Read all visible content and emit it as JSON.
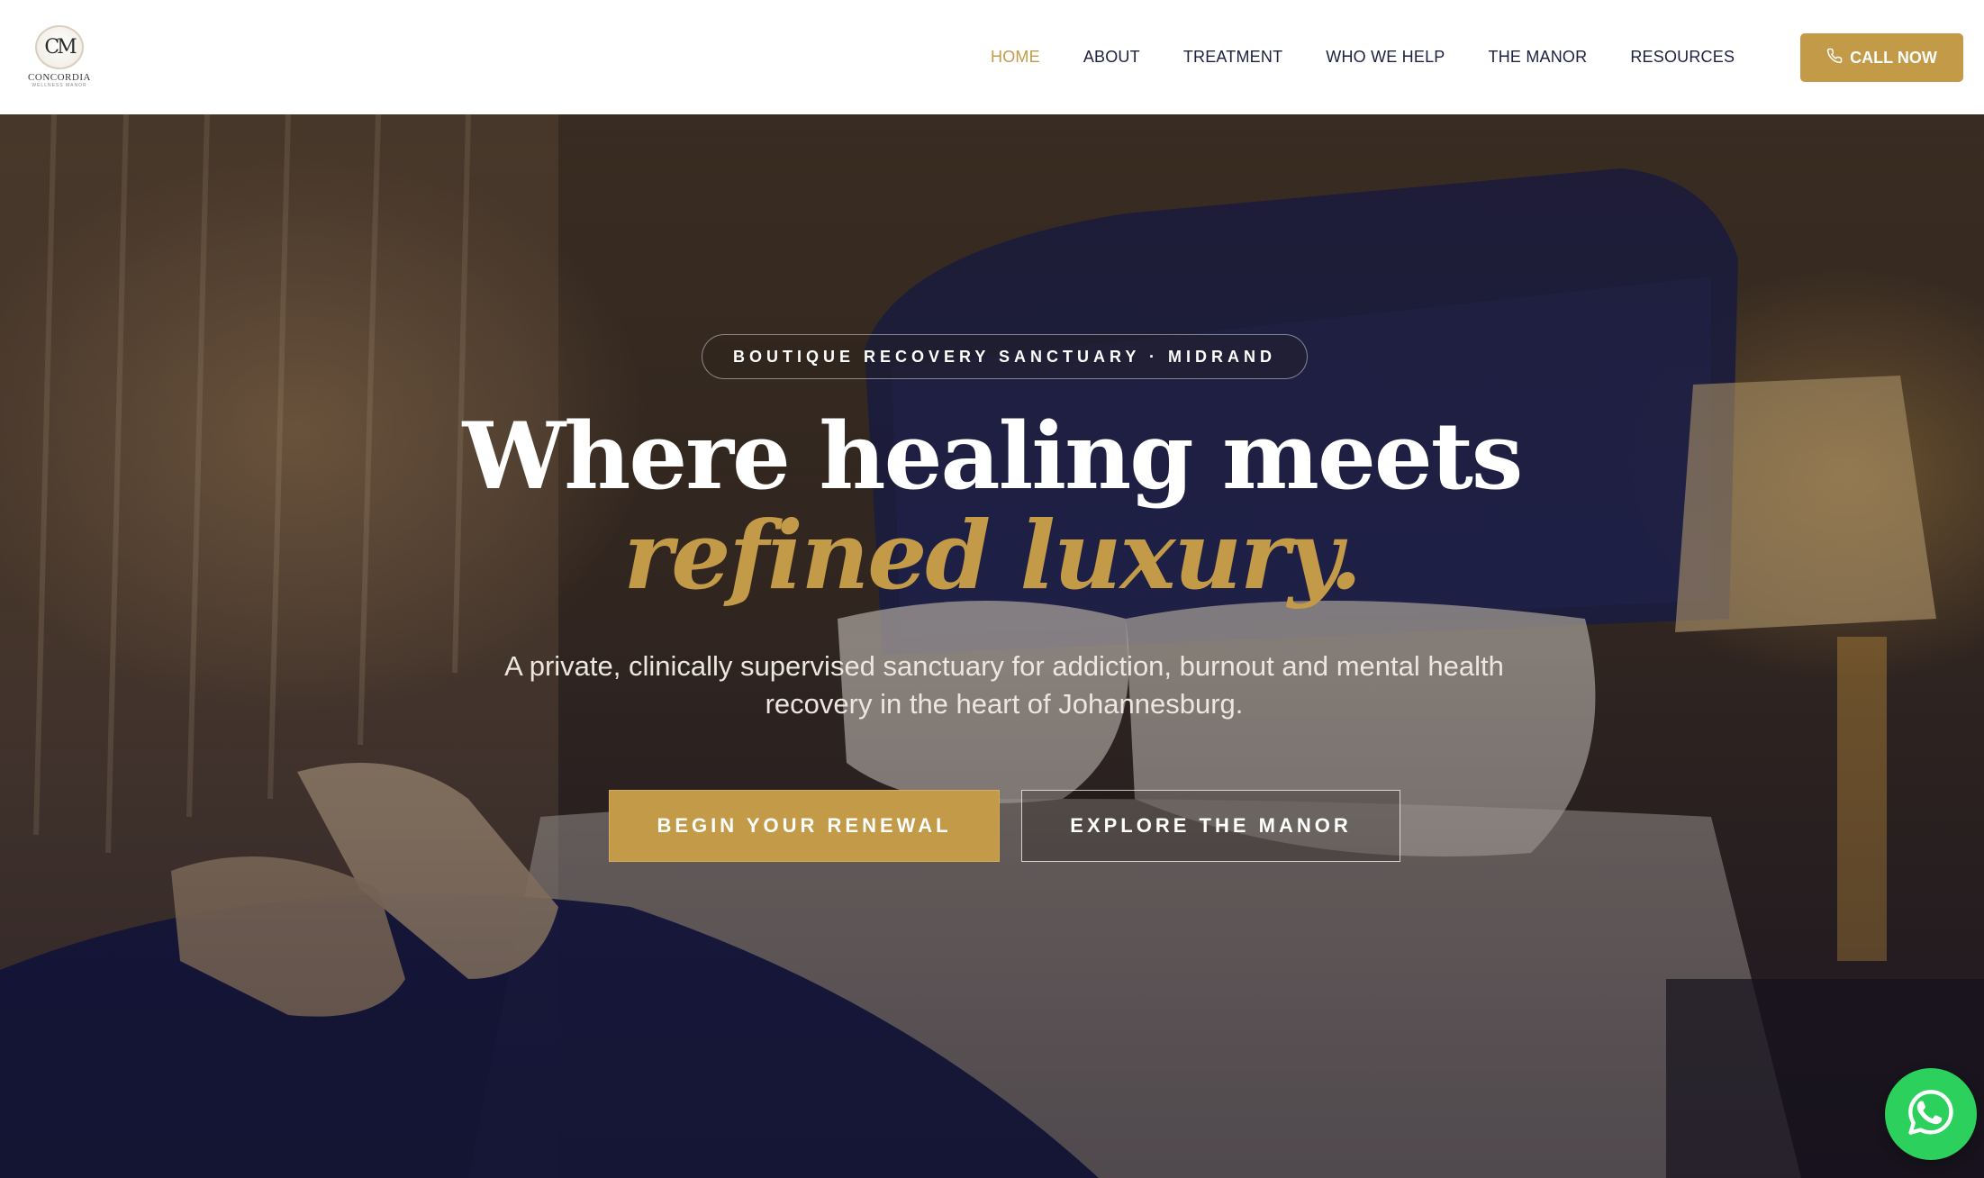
{
  "header": {
    "logo": {
      "text": "CONCORDIA",
      "sub": "WELLNESS MANOR",
      "mark": "CM"
    },
    "nav": [
      {
        "label": "HOME",
        "active": true
      },
      {
        "label": "ABOUT",
        "active": false
      },
      {
        "label": "TREATMENT",
        "active": false
      },
      {
        "label": "WHO WE HELP",
        "active": false
      },
      {
        "label": "THE MANOR",
        "active": false
      },
      {
        "label": "RESOURCES",
        "active": false
      }
    ],
    "call_button": {
      "label": "CALL NOW",
      "icon": "phone-icon"
    }
  },
  "hero": {
    "badge": "BOUTIQUE RECOVERY SANCTUARY · MIDRAND",
    "headline": "Where healing meets",
    "headline_accent": "refined luxury.",
    "subtext": "A private, clinically supervised sanctuary for addiction, burnout and mental health recovery in the heart of Johannesburg.",
    "primary_cta": "BEGIN YOUR RENEWAL",
    "secondary_cta": "EXPLORE THE MANOR"
  },
  "floating": {
    "whatsapp_icon": "whatsapp-icon"
  },
  "colors": {
    "accent": "#c39a48",
    "nav_text": "#1d2040",
    "whatsapp": "#2bd15c",
    "header_bg": "#ffffff"
  }
}
